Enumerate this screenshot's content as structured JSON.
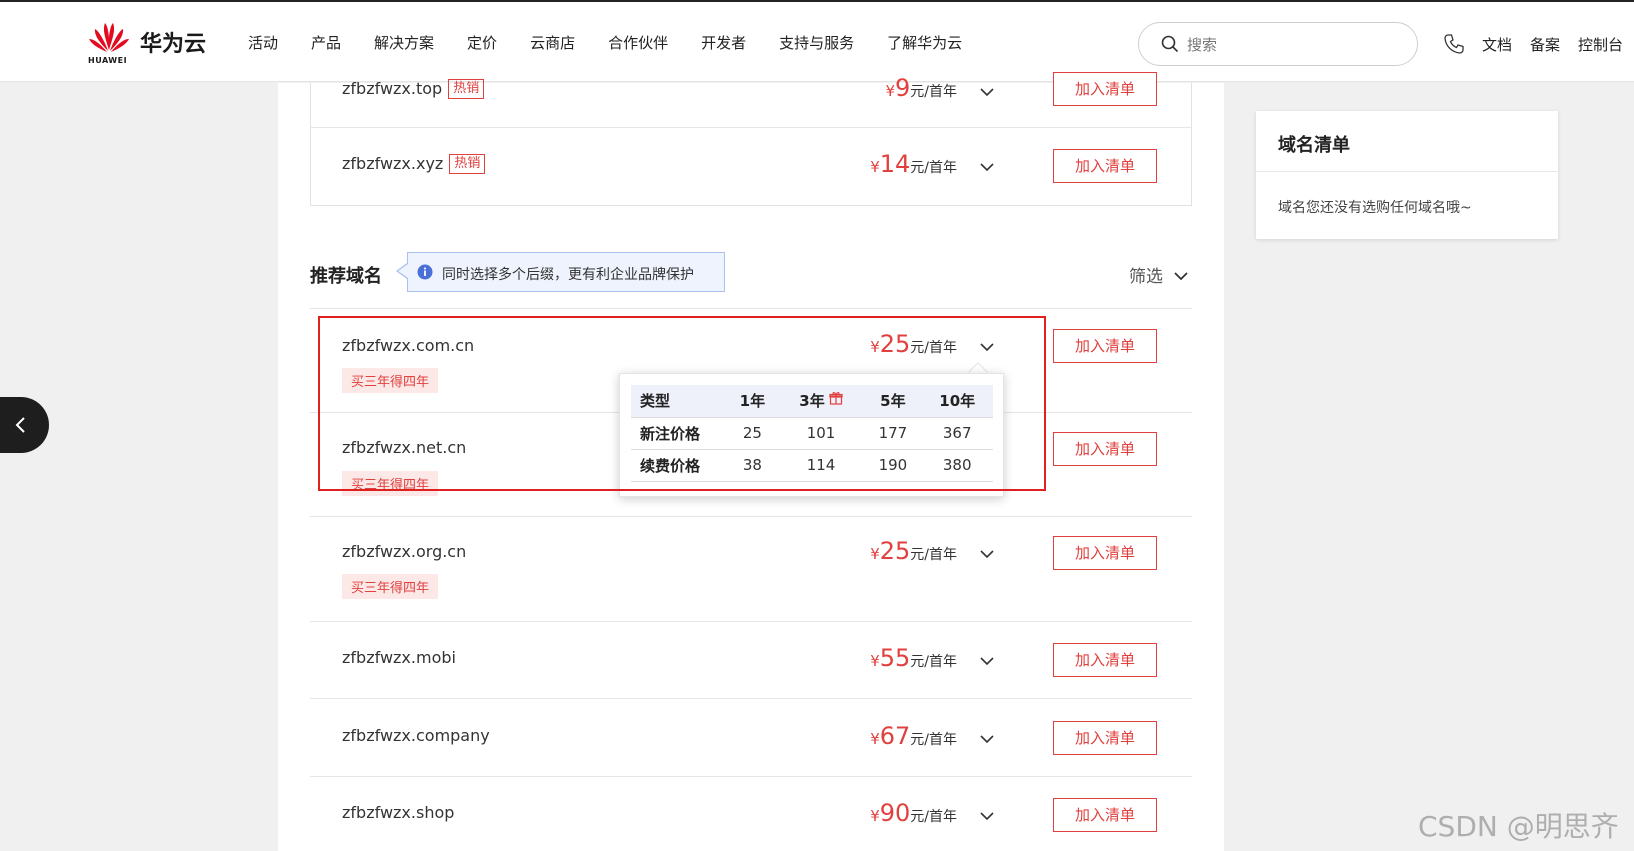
{
  "header": {
    "logo_text": "华为云",
    "logo_sub": "HUAWEI",
    "nav": [
      "活动",
      "产品",
      "解决方案",
      "定价",
      "云商店",
      "合作伙伴",
      "开发者",
      "支持与服务",
      "了解华为云"
    ],
    "search_placeholder": "搜索",
    "links": {
      "docs": "文档",
      "filing": "备案",
      "console": "控制台"
    }
  },
  "hot_domains": [
    {
      "domain": "zfbzfwzx.top",
      "tag": "热销",
      "yen": "¥",
      "amount": "9",
      "unit": "元/首年"
    },
    {
      "domain": "zfbzfwzx.xyz",
      "tag": "热销",
      "yen": "¥",
      "amount": "14",
      "unit": "元/首年"
    }
  ],
  "recommended": {
    "title": "推荐域名",
    "tip": "同时选择多个后缀，更有利企业品牌保护",
    "filter": "筛选",
    "items": [
      {
        "domain": "zfbzfwzx.com.cn",
        "promo": "买三年得四年",
        "yen": "¥",
        "amount": "25",
        "unit": "元/首年"
      },
      {
        "domain": "zfbzfwzx.net.cn",
        "promo": "买三年得四年",
        "yen": "",
        "amount": "",
        "unit": ""
      },
      {
        "domain": "zfbzfwzx.org.cn",
        "promo": "买三年得四年",
        "yen": "¥",
        "amount": "25",
        "unit": "元/首年"
      },
      {
        "domain": "zfbzfwzx.mobi",
        "promo": "",
        "yen": "¥",
        "amount": "55",
        "unit": "元/首年"
      },
      {
        "domain": "zfbzfwzx.company",
        "promo": "",
        "yen": "¥",
        "amount": "67",
        "unit": "元/首年"
      },
      {
        "domain": "zfbzfwzx.shop",
        "promo": "",
        "yen": "¥",
        "amount": "90",
        "unit": "元/首年"
      }
    ]
  },
  "add_label": "加入清单",
  "price_popover": {
    "headers": [
      "类型",
      "1年",
      "3年",
      "5年",
      "10年"
    ],
    "rows": [
      {
        "label": "新注价格",
        "values": [
          "25",
          "101",
          "177",
          "367"
        ]
      },
      {
        "label": "续费价格",
        "values": [
          "38",
          "114",
          "190",
          "380"
        ]
      }
    ]
  },
  "cart": {
    "title": "域名清单",
    "empty_text": "域名您还没有选购任何域名哦~"
  },
  "watermark": "CSDN @明思齐",
  "colors": {
    "accent": "#e0403e",
    "highlight": "#e0201e",
    "tip_bg": "#eef3fd"
  },
  "icons": {
    "search": "search-icon",
    "phone": "phone-icon",
    "chevron": "chevron-down-icon",
    "info": "info-icon",
    "gift": "gift-icon",
    "back": "chevron-left-icon"
  }
}
